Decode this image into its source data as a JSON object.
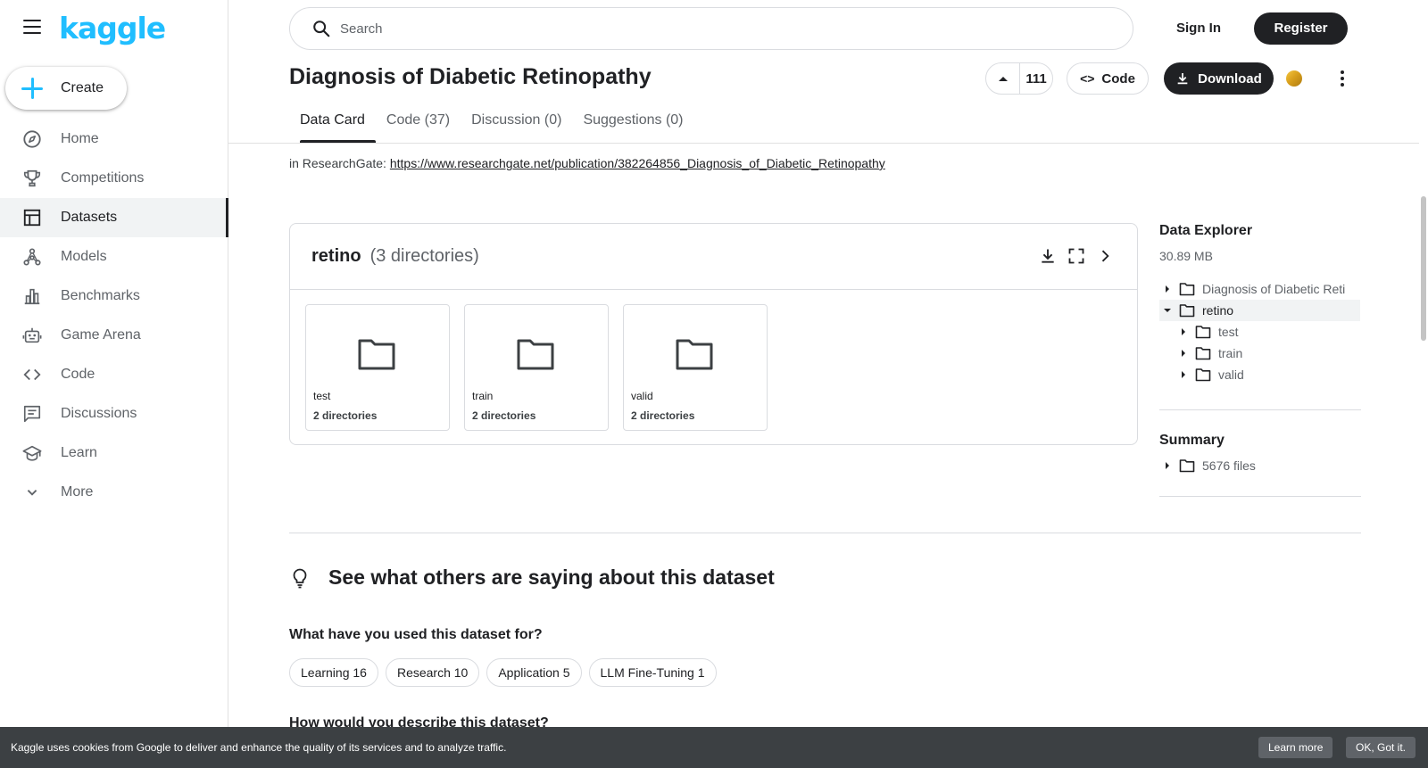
{
  "sidebar": {
    "logo": "kaggle",
    "create_label": "Create",
    "items": [
      {
        "label": "Home",
        "icon": "compass-icon"
      },
      {
        "label": "Competitions",
        "icon": "trophy-icon"
      },
      {
        "label": "Datasets",
        "icon": "table-icon",
        "active": true
      },
      {
        "label": "Models",
        "icon": "models-icon"
      },
      {
        "label": "Benchmarks",
        "icon": "bar-chart-icon"
      },
      {
        "label": "Game Arena",
        "icon": "robot-icon"
      },
      {
        "label": "Code",
        "icon": "code-icon"
      },
      {
        "label": "Discussions",
        "icon": "discussion-icon"
      },
      {
        "label": "Learn",
        "icon": "graduation-cap-icon"
      },
      {
        "label": "More",
        "icon": "chevron-down-icon"
      }
    ]
  },
  "header": {
    "search_placeholder": "Search",
    "sign_in": "Sign In",
    "register": "Register"
  },
  "dataset": {
    "title": "Diagnosis of Diabetic Retinopathy",
    "upvotes": "111",
    "code_label": "Code",
    "download_label": "Download"
  },
  "tabs": [
    {
      "label": "Data Card",
      "active": true
    },
    {
      "label": "Code (37)"
    },
    {
      "label": "Discussion (0)"
    },
    {
      "label": "Suggestions (0)"
    }
  ],
  "citation": {
    "prefix": "in ResearchGate: ",
    "link": "https://www.researchgate.net/publication/382264856_Diagnosis_of_Diabetic_Retinopathy"
  },
  "explorer_card": {
    "name": "retino",
    "subtitle": "(3 directories)",
    "tiles": [
      {
        "name": "test",
        "sub": "2 directories"
      },
      {
        "name": "train",
        "sub": "2 directories"
      },
      {
        "name": "valid",
        "sub": "2 directories"
      }
    ]
  },
  "data_explorer": {
    "title": "Data Explorer",
    "size": "30.89 MB",
    "tree": [
      {
        "label": "Diagnosis of Diabetic Reti",
        "level": 0,
        "expanded": false
      },
      {
        "label": "retino",
        "level": 0,
        "expanded": true,
        "selected": true
      },
      {
        "label": "test",
        "level": 1,
        "expanded": false
      },
      {
        "label": "train",
        "level": 1,
        "expanded": false
      },
      {
        "label": "valid",
        "level": 1,
        "expanded": false
      }
    ]
  },
  "summary": {
    "title": "Summary",
    "files": "5676 files"
  },
  "others": {
    "heading": "See what others are saying about this dataset",
    "question1": "What have you used this dataset for?",
    "chips": [
      "Learning 16",
      "Research 10",
      "Application 5",
      "LLM Fine-Tuning 1"
    ],
    "question2": "How would you describe this dataset?"
  },
  "cookie": {
    "text": "Kaggle uses cookies from Google to deliver and enhance the quality of its services and to analyze traffic.",
    "learn_more": "Learn more",
    "ok": "OK, Got it."
  }
}
